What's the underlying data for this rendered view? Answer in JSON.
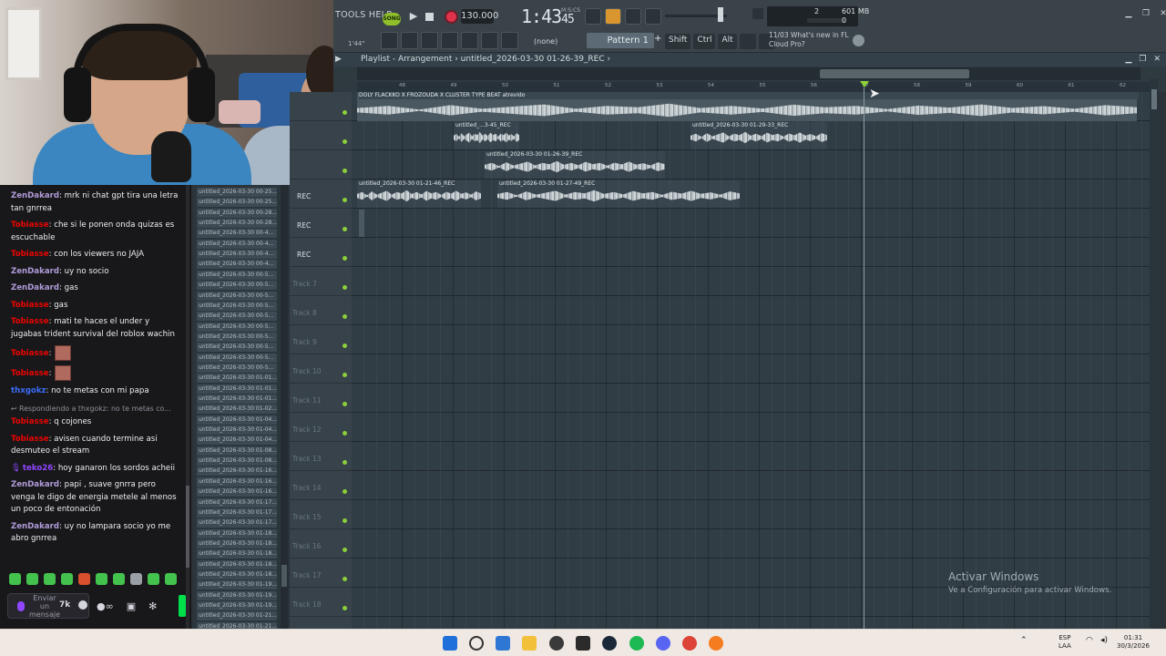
{
  "colors": {
    "accent_green": "#8ccf3a",
    "record_red": "#e0324b",
    "chat_bg": "#18181b",
    "grid_bg": "#313d45",
    "user_red": "#eb0400",
    "user_purple": "#b09bd8",
    "user_blue": "#3b6cf5",
    "user_violet": "#9147ff"
  },
  "chat": {
    "messages": [
      {
        "user": "ZenDakard",
        "color": "#b09bd8",
        "text": ": mrk ni chat gpt tira una letra tan gnrrea"
      },
      {
        "user": "Tobiasse",
        "color": "#eb0400",
        "text": ": che si le ponen onda quizas es escuchable"
      },
      {
        "user": "Tobiasse",
        "color": "#eb0400",
        "text": ": con los viewers no JAJA"
      },
      {
        "user": "ZenDakard",
        "color": "#b09bd8",
        "text": ": uy no socio"
      },
      {
        "user": "ZenDakard",
        "color": "#b09bd8",
        "text": ": gas"
      },
      {
        "user": "Tobiasse",
        "color": "#eb0400",
        "text": ": gas"
      },
      {
        "user": "Tobiasse",
        "color": "#eb0400",
        "text": ": mati te haces el under y jugabas trident survival del roblox wachin"
      },
      {
        "user": "Tobiasse",
        "color": "#eb0400",
        "text": ":",
        "emote": true
      },
      {
        "user": "Tobiasse",
        "color": "#eb0400",
        "text": ":",
        "emote": true
      },
      {
        "user": "thxgokz",
        "color": "#3b6cf5",
        "text": ": no te metas con mi papa"
      },
      {
        "reply": "Respondiendo a thxgokz: no te metas co..."
      },
      {
        "user": "Tobiasse",
        "color": "#eb0400",
        "text": ": q cojones"
      },
      {
        "user": "Tobiasse",
        "color": "#eb0400",
        "text": ": avisen cuando termine asi desmuteo el stream"
      },
      {
        "user": "teko26",
        "color": "#9147ff",
        "text": ": hoy ganaron los sordos acheii",
        "mic": true
      },
      {
        "user": "ZenDakard",
        "color": "#b09bd8",
        "text": ": papi , suave gnrra pero venga le digo de energia metele al menos un poco de entonación"
      },
      {
        "user": "ZenDakard",
        "color": "#b09bd8",
        "text": ": uy no lampara socio yo me abro gnrrea"
      }
    ],
    "input_placeholder": "Enviar un mensaje",
    "gif_label": "7k"
  },
  "fl": {
    "menu": "TOOLS  HELP",
    "song_label": "SONG",
    "tempo": "130.000",
    "time": "1:43",
    "time_small": "45",
    "time_unit": "M:S:CS",
    "cpu_label": "2",
    "cpu_mem": "601 MB",
    "cpu_poly": "0",
    "snap_none": "(none)",
    "pattern": "Pattern 1",
    "mod_keys": [
      "Shift",
      "Ctrl",
      "Alt"
    ],
    "news_line1": "11/03  What's new in FL",
    "news_line2": "Cloud Pro?",
    "tb2_left": "1'44\"",
    "playlist_breadcrumb": "Playlist - Arrangement  ›  untitled_2026-03-30 01-26-39_REC  ›",
    "ruler_ticks": [
      "48",
      "49",
      "50",
      "51",
      "52",
      "53",
      "54",
      "55",
      "56",
      "57",
      "58",
      "59",
      "60",
      "61",
      "62"
    ]
  },
  "picker": {
    "items": [
      "untitled_2026-03-30 00-25...",
      "untitled_2026-03-30 00-25...",
      "untitled_2026-03-30 00-28...",
      "untitled_2026-03-30 00-28...",
      "untitled_2026-03-30 00-4...",
      "untitled_2026-03-30 00-4...",
      "untitled_2026-03-30 00-4...",
      "untitled_2026-03-30 00-4...",
      "untitled_2026-03-30 00-5...",
      "untitled_2026-03-30 00-5...",
      "untitled_2026-03-30 00-5...",
      "untitled_2026-03-30 00-5...",
      "untitled_2026-03-30 00-5...",
      "untitled_2026-03-30 00-5...",
      "untitled_2026-03-30 00-5...",
      "untitled_2026-03-30 00-5...",
      "untitled_2026-03-30 00-5...",
      "untitled_2026-03-30 00-5...",
      "untitled_2026-03-30 01-01...",
      "untitled_2026-03-30 01-01...",
      "untitled_2026-03-30 01-01...",
      "untitled_2026-03-30 01-02...",
      "untitled_2026-03-30 01-04...",
      "untitled_2026-03-30 01-04...",
      "untitled_2026-03-30 01-04...",
      "untitled_2026-03-30 01-08...",
      "untitled_2026-03-30 01-08...",
      "untitled_2026-03-30 01-16...",
      "untitled_2026-03-30 01-16...",
      "untitled_2026-03-30 01-16...",
      "untitled_2026-03-30 01-17...",
      "untitled_2026-03-30 01-17...",
      "untitled_2026-03-30 01-17...",
      "untitled_2026-03-30 01-18...",
      "untitled_2026-03-30 01-18...",
      "untitled_2026-03-30 01-18...",
      "untitled_2026-03-30 01-18...",
      "untitled_2026-03-30 01-18...",
      "untitled_2026-03-30 01-19...",
      "untitled_2026-03-30 01-19...",
      "untitled_2026-03-30 01-19...",
      "untitled_2026-03-30 01-21...",
      "untitled_2026-03-30 01-21...",
      "untitled_2026-03-30 01-23..."
    ]
  },
  "tracks": {
    "headers": [
      "",
      "",
      "",
      "REC",
      "REC",
      "REC",
      "Track 7",
      "Track 8",
      "Track 9",
      "Track 10",
      "Track 11",
      "Track 12",
      "Track 13",
      "Track 14",
      "Track 15",
      "Track 16",
      "Track 17",
      "Track 18",
      "Track 19"
    ],
    "clips": {
      "main": "DOLY FLACKKO X FROZOUDA X CLUSTER TYPE BEAT atrevido",
      "c1": "untitled_...3-45_REC",
      "c2": "untitled_2026-03-30 01-29-33_REC",
      "c3": "untitled_2026-03-30 01-26-39_REC",
      "c4": "untitled_2026-03-30 01-21-46_REC",
      "c5": "untitled_2026-03-30 01-27-49_REC"
    }
  },
  "watermark": {
    "line1": "Activar Windows",
    "line2": "Ve a Configuración para activar Windows."
  },
  "taskbar": {
    "lang1": "ESP",
    "lang2": "LAA",
    "clock": "01:31",
    "date": "30/3/2026"
  }
}
